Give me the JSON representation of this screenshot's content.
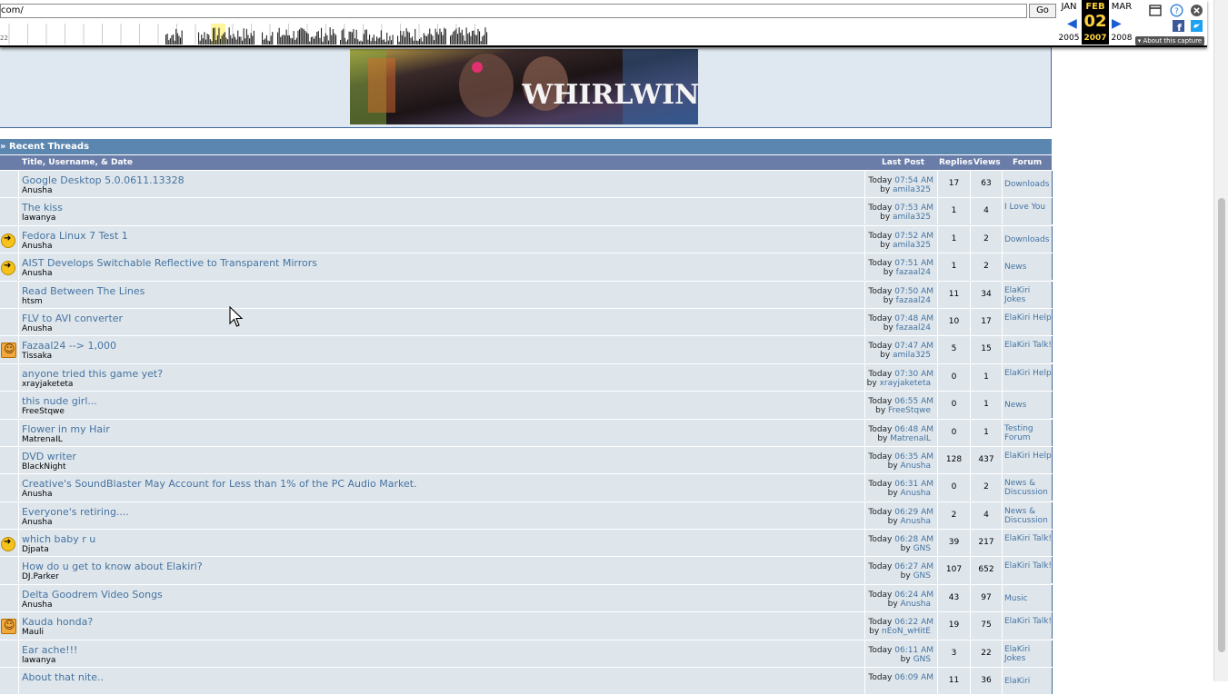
{
  "wayback": {
    "url_value": "com/",
    "go_label": "Go",
    "spark_year_label": "22",
    "prev_month": "JAN",
    "prev_year": "2005",
    "current_month": "FEB",
    "current_day": "02",
    "current_year": "2007",
    "next_month": "MAR",
    "next_year": "2008",
    "about_label": "About this capture",
    "icons": [
      "calendar-icon",
      "help-icon",
      "close-icon",
      "facebook-icon",
      "twitter-icon"
    ]
  },
  "banner": {
    "text": "WHIRLWIND"
  },
  "recent_threads": {
    "heading": "» Recent Threads",
    "columns": {
      "title": "Title, Username, & Date",
      "last_post": "Last Post",
      "replies": "Replies",
      "views": "Views",
      "forum": "Forum"
    },
    "rows": [
      {
        "icon": "",
        "title": "Google Desktop 5.0.0611.13328",
        "user": "Anusha",
        "day": "Today",
        "time": "07:54 AM",
        "by": "amila325",
        "replies": "17",
        "views": "63",
        "forum": "Downloads"
      },
      {
        "icon": "",
        "title": "The kiss",
        "user": "lawanya",
        "day": "Today",
        "time": "07:53 AM",
        "by": "amila325",
        "replies": "1",
        "views": "4",
        "forum": "I Love You"
      },
      {
        "icon": "arrow",
        "title": "Fedora Linux 7 Test 1",
        "user": "Anusha",
        "day": "Today",
        "time": "07:52 AM",
        "by": "amila325",
        "replies": "1",
        "views": "2",
        "forum": "Downloads"
      },
      {
        "icon": "arrow",
        "title": "AIST Develops Switchable Reflective to Transparent Mirrors",
        "user": "Anusha",
        "day": "Today",
        "time": "07:51 AM",
        "by": "fazaal24",
        "replies": "1",
        "views": "2",
        "forum": "News"
      },
      {
        "icon": "",
        "title": "Read Between The Lines",
        "user": "htsm",
        "day": "Today",
        "time": "07:50 AM",
        "by": "fazaal24",
        "replies": "11",
        "views": "34",
        "forum": "ElaKiri Jokes"
      },
      {
        "icon": "",
        "title": "FLV to AVI converter",
        "user": "Anusha",
        "day": "Today",
        "time": "07:48 AM",
        "by": "fazaal24",
        "replies": "10",
        "views": "17",
        "forum": "ElaKiri Help"
      },
      {
        "icon": "smile",
        "title": "Fazaal24 --> 1,000",
        "user": "Tissaka",
        "day": "Today",
        "time": "07:47 AM",
        "by": "amila325",
        "replies": "5",
        "views": "15",
        "forum": "ElaKiri Talk!"
      },
      {
        "icon": "",
        "title": "anyone tried this game yet?",
        "user": "xrayjaketeta",
        "day": "Today",
        "time": "07:30 AM",
        "by": "xrayjaketeta",
        "replies": "0",
        "views": "1",
        "forum": "ElaKiri Help"
      },
      {
        "icon": "",
        "title": "this nude girl...",
        "user": "FreeStqwe",
        "day": "Today",
        "time": "06:55 AM",
        "by": "FreeStqwe",
        "replies": "0",
        "views": "1",
        "forum": "News"
      },
      {
        "icon": "",
        "title": "Flower in my Hair",
        "user": "MatrenaIL",
        "day": "Today",
        "time": "06:48 AM",
        "by": "MatrenaIL",
        "replies": "0",
        "views": "1",
        "forum": "Testing Forum"
      },
      {
        "icon": "",
        "title": "DVD writer",
        "user": "BlackNight",
        "day": "Today",
        "time": "06:35 AM",
        "by": "Anusha",
        "replies": "128",
        "views": "437",
        "forum": "ElaKiri Help"
      },
      {
        "icon": "",
        "title": "Creative's SoundBlaster May Account for Less than 1% of the PC Audio Market.",
        "user": "Anusha",
        "day": "Today",
        "time": "06:31 AM",
        "by": "Anusha",
        "replies": "0",
        "views": "2",
        "forum": "News & Discussion"
      },
      {
        "icon": "",
        "title": "Everyone's retiring....",
        "user": "Anusha",
        "day": "Today",
        "time": "06:29 AM",
        "by": "Anusha",
        "replies": "2",
        "views": "4",
        "forum": "News & Discussion"
      },
      {
        "icon": "arrow",
        "title": "which baby r u",
        "user": "Djpata",
        "day": "Today",
        "time": "06:28 AM",
        "by": "GNS",
        "replies": "39",
        "views": "217",
        "forum": "ElaKiri Talk!"
      },
      {
        "icon": "",
        "title": "How do u get to know about Elakiri?",
        "user": "DJ.Parker",
        "day": "Today",
        "time": "06:27 AM",
        "by": "GNS",
        "replies": "107",
        "views": "652",
        "forum": "ElaKiri Talk!"
      },
      {
        "icon": "",
        "title": "Delta Goodrem Video Songs",
        "user": "Anusha",
        "day": "Today",
        "time": "06:24 AM",
        "by": "Anusha",
        "replies": "43",
        "views": "97",
        "forum": "Music"
      },
      {
        "icon": "smile",
        "title": "Kauda honda?",
        "user": "Mauli",
        "day": "Today",
        "time": "06:22 AM",
        "by": "nEoN_wHitE",
        "replies": "19",
        "views": "75",
        "forum": "ElaKiri Talk!"
      },
      {
        "icon": "",
        "title": "Ear ache!!!",
        "user": "lawanya",
        "day": "Today",
        "time": "06:11 AM",
        "by": "GNS",
        "replies": "3",
        "views": "22",
        "forum": "ElaKiri Jokes"
      },
      {
        "icon": "",
        "title": "About that nite..",
        "user": "",
        "day": "Today",
        "time": "06:09 AM",
        "by": "",
        "replies": "11",
        "views": "36",
        "forum": "ElaKiri"
      }
    ]
  },
  "colors": {
    "row_bg": "#dee6ec",
    "link": "#4673a0",
    "header_bar": "#5b86b0",
    "column_bar": "#6a7ca8",
    "wayback_current": "#ffd23c"
  }
}
